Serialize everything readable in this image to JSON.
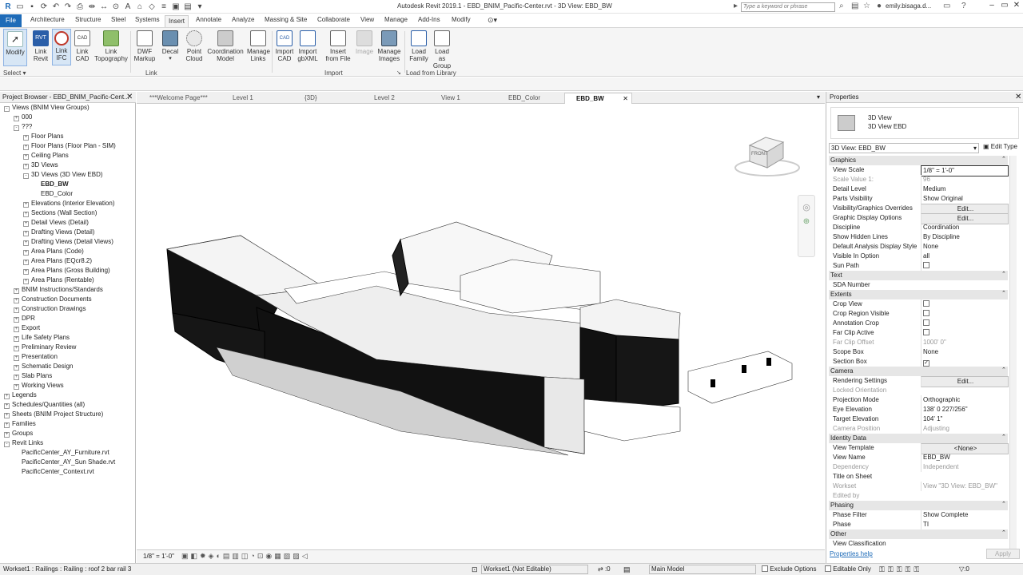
{
  "app": {
    "title": "Autodesk Revit 2019.1 - EBD_BNIM_Pacific-Center.rvt - 3D View: EBD_BW",
    "search_placeholder": "Type a keyword or phrase",
    "user": "emily.bisaga.d...",
    "logo": "R"
  },
  "menu": {
    "file": "File",
    "tabs": [
      "Architecture",
      "Structure",
      "Steel",
      "Systems",
      "Insert",
      "Annotate",
      "Analyze",
      "Massing & Site",
      "Collaborate",
      "View",
      "Manage",
      "Add-Ins",
      "Modify"
    ]
  },
  "ribbon": {
    "buttons": [
      {
        "label": "Modify",
        "icon": "cursor-icon"
      },
      {
        "label": "Link Revit",
        "icon": "link-revit-icon"
      },
      {
        "label": "Link IFC",
        "icon": "link-ifc-icon"
      },
      {
        "label": "Link CAD",
        "icon": "link-cad-icon"
      },
      {
        "label": "Link Topography",
        "icon": "topography-icon"
      },
      {
        "label": "DWF Markup",
        "icon": "dwf-icon"
      },
      {
        "label": "Decal",
        "icon": "decal-icon"
      },
      {
        "label": "Point Cloud",
        "icon": "point-cloud-icon"
      },
      {
        "label": "Coordination Model",
        "icon": "coordination-model-icon"
      },
      {
        "label": "Manage Links",
        "icon": "manage-links-icon"
      },
      {
        "label": "Import CAD",
        "icon": "import-cad-icon"
      },
      {
        "label": "Import gbXML",
        "icon": "import-gbxml-icon"
      },
      {
        "label": "Insert from File",
        "icon": "insert-file-icon"
      },
      {
        "label": "Image",
        "icon": "image-icon"
      },
      {
        "label": "Manage Images",
        "icon": "manage-images-icon"
      },
      {
        "label": "Load Family",
        "icon": "load-family-icon"
      },
      {
        "label": "Load as Group",
        "icon": "load-group-icon"
      }
    ],
    "groups": {
      "select": "Select",
      "link": "Link",
      "import": "Import",
      "load": "Load from Library"
    }
  },
  "browser": {
    "title": "Project Browser - EBD_BNIM_Pacific-Cent...",
    "items": [
      {
        "label": "Views (BNIM View Groups)",
        "level": 0,
        "toggle": "-"
      },
      {
        "label": "000",
        "level": 1,
        "toggle": "+"
      },
      {
        "label": "???",
        "level": 1,
        "toggle": "-"
      },
      {
        "label": "Floor Plans",
        "level": 2,
        "toggle": "+"
      },
      {
        "label": "Floor Plans (Floor Plan - SIM)",
        "level": 2,
        "toggle": "+"
      },
      {
        "label": "Ceiling Plans",
        "level": 2,
        "toggle": "+"
      },
      {
        "label": "3D Views",
        "level": 2,
        "toggle": "+"
      },
      {
        "label": "3D Views (3D View EBD)",
        "level": 2,
        "toggle": "-"
      },
      {
        "label": "EBD_BW",
        "level": 3,
        "toggle": "",
        "selected": true
      },
      {
        "label": "EBD_Color",
        "level": 3,
        "toggle": ""
      },
      {
        "label": "Elevations (Interior Elevation)",
        "level": 2,
        "toggle": "+"
      },
      {
        "label": "Sections (Wall Section)",
        "level": 2,
        "toggle": "+"
      },
      {
        "label": "Detail Views (Detail)",
        "level": 2,
        "toggle": "+"
      },
      {
        "label": "Drafting Views (Detail)",
        "level": 2,
        "toggle": "+"
      },
      {
        "label": "Drafting Views (Detail Views)",
        "level": 2,
        "toggle": "+"
      },
      {
        "label": "Area Plans (Code)",
        "level": 2,
        "toggle": "+"
      },
      {
        "label": "Area Plans (EQcr8.2)",
        "level": 2,
        "toggle": "+"
      },
      {
        "label": "Area Plans (Gross Building)",
        "level": 2,
        "toggle": "+"
      },
      {
        "label": "Area Plans (Rentable)",
        "level": 2,
        "toggle": "+"
      },
      {
        "label": "BNIM Instructions/Standards",
        "level": 1,
        "toggle": "+"
      },
      {
        "label": "Construction Documents",
        "level": 1,
        "toggle": "+"
      },
      {
        "label": "Construction Drawings",
        "level": 1,
        "toggle": "+"
      },
      {
        "label": "DPR",
        "level": 1,
        "toggle": "+"
      },
      {
        "label": "Export",
        "level": 1,
        "toggle": "+"
      },
      {
        "label": "Life Safety Plans",
        "level": 1,
        "toggle": "+"
      },
      {
        "label": "Preliminary Review",
        "level": 1,
        "toggle": "+"
      },
      {
        "label": "Presentation",
        "level": 1,
        "toggle": "+"
      },
      {
        "label": "Schematic Design",
        "level": 1,
        "toggle": "+"
      },
      {
        "label": "Slab Plans",
        "level": 1,
        "toggle": "+"
      },
      {
        "label": "Working Views",
        "level": 1,
        "toggle": "+"
      },
      {
        "label": "Legends",
        "level": 0,
        "toggle": "+"
      },
      {
        "label": "Schedules/Quantities (all)",
        "level": 0,
        "toggle": "+"
      },
      {
        "label": "Sheets (BNIM Project Structure)",
        "level": 0,
        "toggle": "+"
      },
      {
        "label": "Families",
        "level": 0,
        "toggle": "+"
      },
      {
        "label": "Groups",
        "level": 0,
        "toggle": "+"
      },
      {
        "label": "Revit Links",
        "level": 0,
        "toggle": "-"
      },
      {
        "label": "PacificCenter_AY_Furniture.rvt",
        "level": 1,
        "toggle": ""
      },
      {
        "label": "PacificCenter_AY_Sun Shade.rvt",
        "level": 1,
        "toggle": ""
      },
      {
        "label": "PacificCenter_Context.rvt",
        "level": 1,
        "toggle": ""
      }
    ]
  },
  "view_tabs": [
    {
      "label": "***Welcome Page***"
    },
    {
      "label": "Level 1"
    },
    {
      "label": "{3D}"
    },
    {
      "label": "Level 2"
    },
    {
      "label": "View 1"
    },
    {
      "label": "EBD_Color"
    },
    {
      "label": "EBD_BW",
      "active": true
    }
  ],
  "viewcube": {
    "face": "FRONT"
  },
  "view_control": {
    "scale": "1/8\" = 1'-0\""
  },
  "properties": {
    "title": "Properties",
    "type_name": "3D View",
    "type_sub": "3D View EBD",
    "selector": "3D View: EBD_BW",
    "edit_type": "Edit Type",
    "rows": [
      {
        "sec": "Graphics"
      },
      {
        "k": "View Scale",
        "v": "1/8\" = 1'-0\"",
        "box": true
      },
      {
        "k": "Scale Value    1:",
        "v": "96",
        "dim": true
      },
      {
        "k": "Detail Level",
        "v": "Medium"
      },
      {
        "k": "Parts Visibility",
        "v": "Show Original"
      },
      {
        "k": "Visibility/Graphics Overrides",
        "v": "Edit...",
        "btn": true
      },
      {
        "k": "Graphic Display Options",
        "v": "Edit...",
        "btn": true
      },
      {
        "k": "Discipline",
        "v": "Coordination"
      },
      {
        "k": "Show Hidden Lines",
        "v": "By Discipline"
      },
      {
        "k": "Default Analysis Display Style",
        "v": "None"
      },
      {
        "k": "Visible In Option",
        "v": "all"
      },
      {
        "k": "Sun Path",
        "v": "",
        "check": false
      },
      {
        "sec": "Text"
      },
      {
        "k": "SDA Number",
        "v": ""
      },
      {
        "sec": "Extents"
      },
      {
        "k": "Crop View",
        "v": "",
        "check": false
      },
      {
        "k": "Crop Region Visible",
        "v": "",
        "check": false
      },
      {
        "k": "Annotation Crop",
        "v": "",
        "check": false
      },
      {
        "k": "Far Clip Active",
        "v": "",
        "check": false
      },
      {
        "k": "Far Clip Offset",
        "v": "1000'  0\"",
        "dim": true
      },
      {
        "k": "Scope Box",
        "v": "None"
      },
      {
        "k": "Section Box",
        "v": "",
        "check": true
      },
      {
        "sec": "Camera"
      },
      {
        "k": "Rendering Settings",
        "v": "Edit...",
        "btn": true
      },
      {
        "k": "Locked Orientation",
        "v": "",
        "dim": true
      },
      {
        "k": "Projection Mode",
        "v": "Orthographic"
      },
      {
        "k": "Eye Elevation",
        "v": "138'  0 227/256\""
      },
      {
        "k": "Target Elevation",
        "v": "104'  1\""
      },
      {
        "k": "Camera Position",
        "v": "Adjusting",
        "dim": true
      },
      {
        "sec": "Identity Data"
      },
      {
        "k": "View Template",
        "v": "<None>",
        "btn": true
      },
      {
        "k": "View Name",
        "v": "EBD_BW"
      },
      {
        "k": "Dependency",
        "v": "Independent",
        "dim": true
      },
      {
        "k": "Title on Sheet",
        "v": ""
      },
      {
        "k": "Workset",
        "v": "View \"3D View: EBD_BW\"",
        "dim": true
      },
      {
        "k": "Edited by",
        "v": "",
        "dim": true
      },
      {
        "sec": "Phasing"
      },
      {
        "k": "Phase Filter",
        "v": "Show Complete"
      },
      {
        "k": "Phase",
        "v": "TI"
      },
      {
        "sec": "Other"
      },
      {
        "k": "View Classification",
        "v": ""
      }
    ],
    "help_link": "Properties help",
    "apply": "Apply"
  },
  "status": {
    "message": "Workset1 : Railings : Railing : roof 2 bar rail 3",
    "workset": "Workset1 (Not Editable)",
    "zero": ":0",
    "model": "Main Model",
    "exclude_options": "Exclude Options",
    "editable_only": "Editable Only",
    "filter_count": ":0"
  }
}
